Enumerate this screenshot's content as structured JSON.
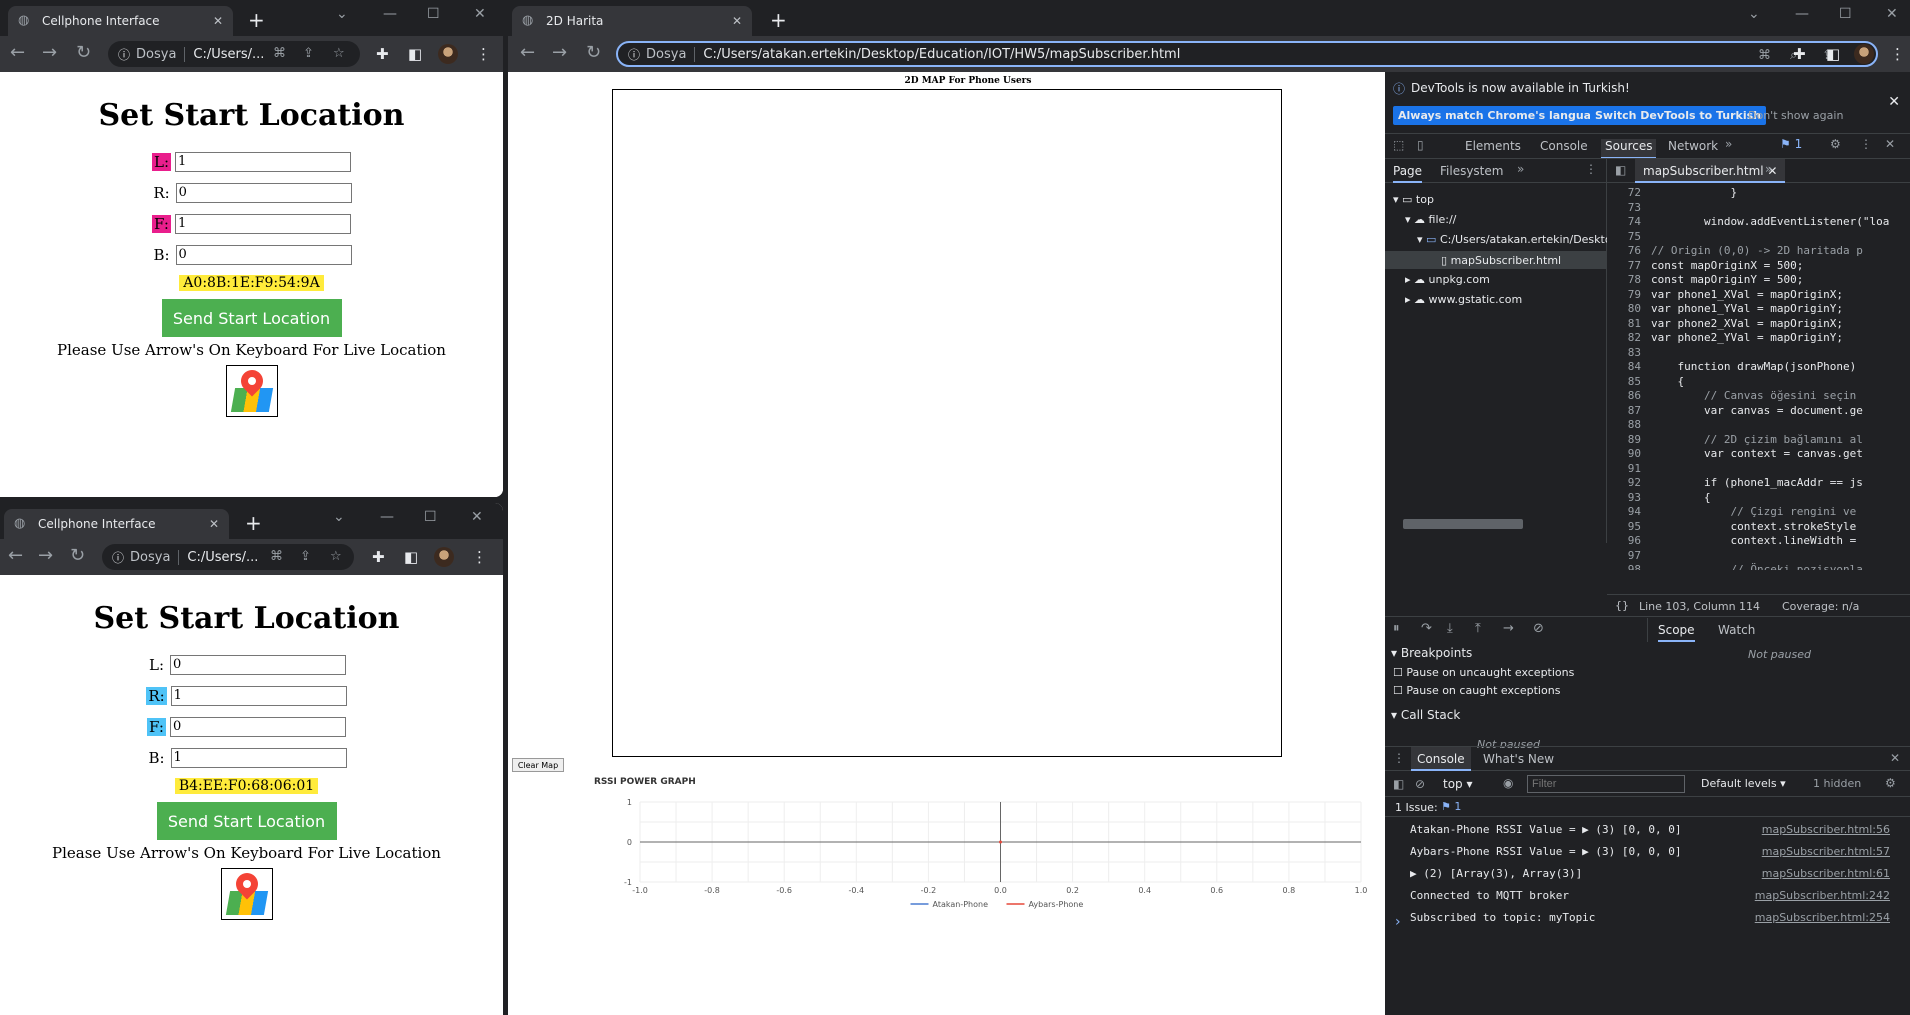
{
  "win1": {
    "tab_title": "Cellphone Interface",
    "dosya": "Dosya",
    "url": "C:/Users/...",
    "heading": "Set Start Location",
    "fields": [
      {
        "label": "L:",
        "value": "1"
      },
      {
        "label": "R:",
        "value": "0"
      },
      {
        "label": "F:",
        "value": "1"
      },
      {
        "label": "B:",
        "value": "0"
      }
    ],
    "mac": "A0:8B:1E:F9:54:9A",
    "send": "Send Start Location",
    "hint": "Please Use Arrow's On Keyboard For Live Location"
  },
  "win2": {
    "tab_title": "Cellphone Interface",
    "dosya": "Dosya",
    "url": "C:/Users/...",
    "heading": "Set Start Location",
    "fields": [
      {
        "label": "L:",
        "value": "0"
      },
      {
        "label": "R:",
        "value": "1"
      },
      {
        "label": "F:",
        "value": "0"
      },
      {
        "label": "B:",
        "value": "1"
      }
    ],
    "mac": "B4:EE:F0:68:06:01",
    "send": "Send Start Location",
    "hint": "Please Use Arrow's On Keyboard For Live Location"
  },
  "main": {
    "tab_title": "2D Harita",
    "dosya": "Dosya",
    "url": "C:/Users/atakan.ertekin/Desktop/Education/IOT/HW5/mapSubscriber.html",
    "map_title": "2D MAP For Phone Users",
    "clear_btn": "Clear Map"
  },
  "chart_data": {
    "type": "line",
    "title": "RSSI POWER GRAPH",
    "xlim": [
      -1.0,
      1.0
    ],
    "ylim": [
      -1,
      1
    ],
    "x_ticks": [
      "-1.0",
      "-0.8",
      "-0.6",
      "-0.4",
      "-0.2",
      "0.0",
      "0.2",
      "0.4",
      "0.6",
      "0.8",
      "1.0"
    ],
    "y_ticks": [
      "1",
      "0",
      "-1"
    ],
    "series": [
      {
        "name": "Atakan-Phone",
        "color": "#4a7bd0",
        "values": []
      },
      {
        "name": "Aybars-Phone",
        "color": "#e5483a",
        "values": []
      }
    ],
    "grid": true,
    "legend": "bottom"
  },
  "devtools": {
    "banner": "DevTools is now available in Turkish!",
    "btn_match": "Always match Chrome's language",
    "btn_switch": "Switch DevTools to Turkish",
    "btn_dont": "Don't show again",
    "tabs": [
      "Elements",
      "Console",
      "Sources",
      "Network"
    ],
    "badge": "1",
    "nav_tabs": [
      "Page",
      "Filesystem"
    ],
    "file_tab": "mapSubscriber.html",
    "tree": [
      "top",
      "file://",
      "C:/Users/atakan.ertekin/Deskto",
      "mapSubscriber.html",
      "unpkg.com",
      "www.gstatic.com"
    ],
    "code_lines": [
      {
        "n": "72",
        "t": "            }"
      },
      {
        "n": "73",
        "t": ""
      },
      {
        "n": "74",
        "t": "        window.addEventListener(\"loa"
      },
      {
        "n": "75",
        "t": ""
      },
      {
        "n": "76",
        "t": "// Origin (0,0) -> 2D haritada p"
      },
      {
        "n": "77",
        "t": "const mapOriginX = 500;"
      },
      {
        "n": "78",
        "t": "const mapOriginY = 500;"
      },
      {
        "n": "79",
        "t": "var phone1_XVal = mapOriginX;"
      },
      {
        "n": "80",
        "t": "var phone1_YVal = mapOriginY;"
      },
      {
        "n": "81",
        "t": "var phone2_XVal = mapOriginX;"
      },
      {
        "n": "82",
        "t": "var phone2_YVal = mapOriginY;"
      },
      {
        "n": "83",
        "t": ""
      },
      {
        "n": "84",
        "t": "    function drawMap(jsonPhone)"
      },
      {
        "n": "85",
        "t": "    {"
      },
      {
        "n": "86",
        "t": "        // Canvas öğesini seçin"
      },
      {
        "n": "87",
        "t": "        var canvas = document.ge"
      },
      {
        "n": "88",
        "t": ""
      },
      {
        "n": "89",
        "t": "        // 2D çizim bağlamını al"
      },
      {
        "n": "90",
        "t": "        var context = canvas.get"
      },
      {
        "n": "91",
        "t": ""
      },
      {
        "n": "92",
        "t": "        if (phone1_macAddr == js"
      },
      {
        "n": "93",
        "t": "        {"
      },
      {
        "n": "94",
        "t": "            // Çizgi rengini ve"
      },
      {
        "n": "95",
        "t": "            context.strokeStyle"
      },
      {
        "n": "96",
        "t": "            context.lineWidth ="
      },
      {
        "n": "97",
        "t": ""
      },
      {
        "n": "98",
        "t": "            // Önceki pozisyonla"
      }
    ],
    "status_pos": "Line 103, Column 114",
    "coverage": "Coverage: n/a",
    "scope_tab": "Scope",
    "watch_tab": "Watch",
    "not_paused": "Not paused",
    "breakpoints": "Breakpoints",
    "pause_uncaught": "Pause on uncaught exceptions",
    "pause_caught": "Pause on caught exceptions",
    "call_stack": "Call Stack",
    "not_paused2": "Not paused",
    "console_tab": "Console",
    "whats_new": "What's New",
    "context": "top",
    "filter_ph": "Filter",
    "levels": "Default levels",
    "hidden": "1 hidden",
    "issue": "1 Issue:",
    "issue_n": "1",
    "console": [
      {
        "text": "Atakan-Phone RSSI Value =  ▶ (3) [0, 0, 0]",
        "link": "mapSubscriber.html:56"
      },
      {
        "text": "Aybars-Phone RSSI Value =  ▶ (3) [0, 0, 0]",
        "link": "mapSubscriber.html:57"
      },
      {
        "text": " ▶ (2) [Array(3), Array(3)]",
        "link": "mapSubscriber.html:61"
      },
      {
        "text": "Connected to MQTT broker",
        "link": "mapSubscriber.html:242"
      },
      {
        "text": "Subscribed to topic: myTopic",
        "link": "mapSubscriber.html:254"
      }
    ],
    "prompt": "›"
  }
}
